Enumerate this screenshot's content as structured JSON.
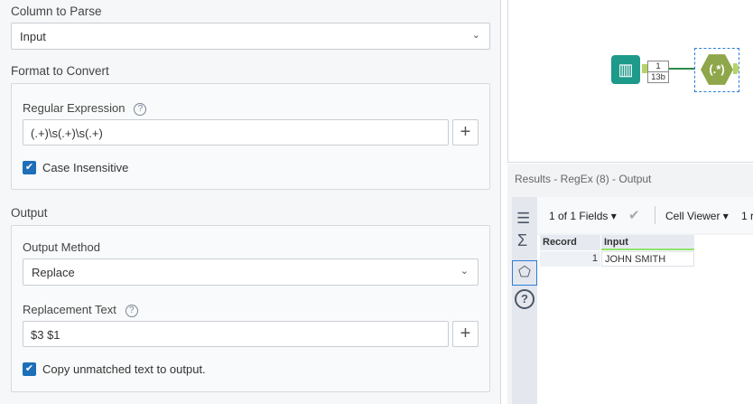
{
  "column_to_parse": {
    "label": "Column to Parse",
    "value": "Input"
  },
  "format": {
    "label": "Format to Convert",
    "regex_label": "Regular Expression",
    "regex_value": "(.+)\\s(.+)\\s(.+)",
    "case_insensitive": "Case Insensitive"
  },
  "output": {
    "label": "Output",
    "method_label": "Output Method",
    "method_value": "Replace",
    "replacement_label": "Replacement Text",
    "replacement_value": "$3 $1",
    "copy_unmatched": "Copy unmatched text to output."
  },
  "workflow": {
    "record_count": "1",
    "size": "13b",
    "regex_icon": "(.*)"
  },
  "results": {
    "title": "Results - RegEx (8) - Output",
    "fields": "1 of 1 Fields",
    "cell_viewer": "Cell Viewer",
    "more": "1 r",
    "columns": [
      "Record",
      "Input"
    ],
    "rows": [
      {
        "record": "1",
        "input": "JOHN SMITH"
      }
    ]
  }
}
